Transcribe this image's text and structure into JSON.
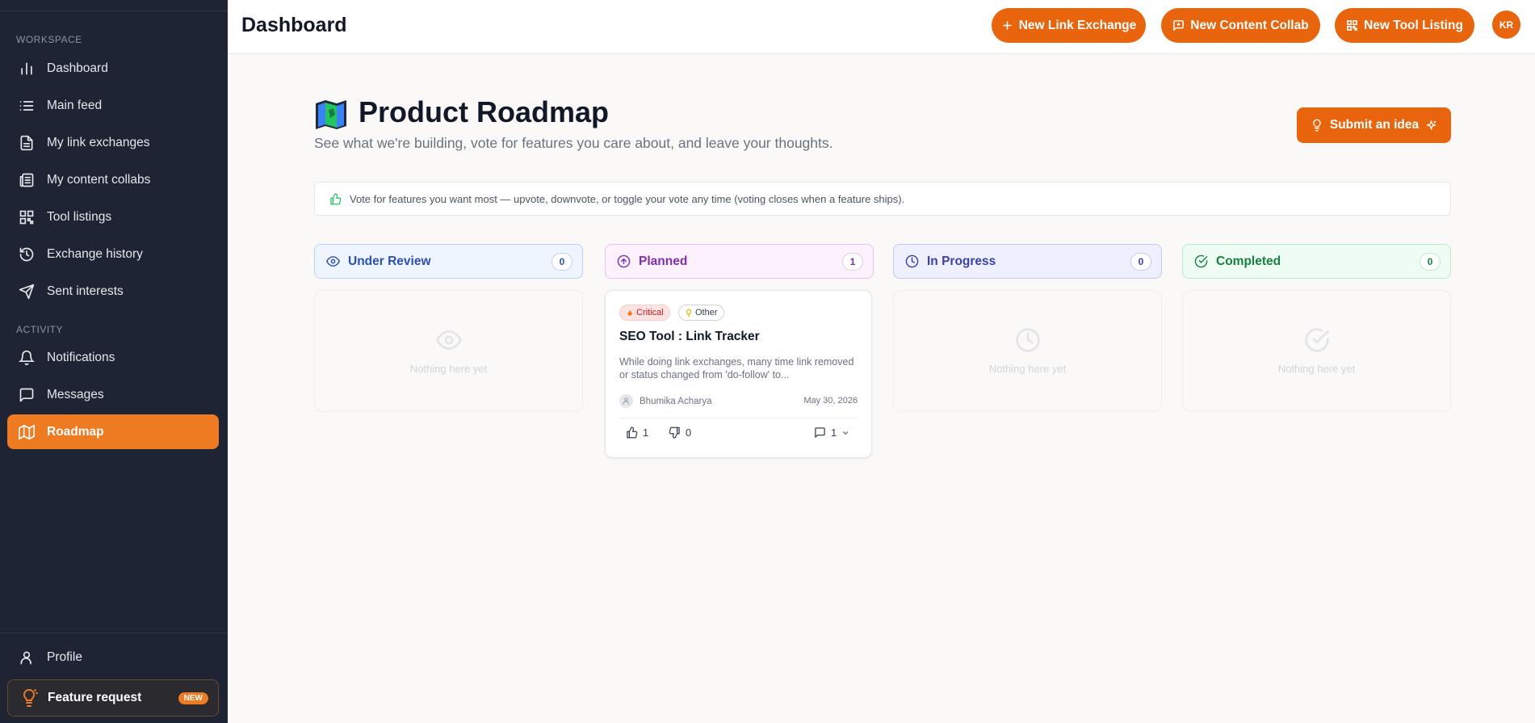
{
  "sidebar": {
    "workspace_label": "WORKSPACE",
    "activity_label": "ACTIVITY",
    "workspace_items": [
      {
        "label": "Dashboard",
        "icon": "chart-bar-icon"
      },
      {
        "label": "Main feed",
        "icon": "list-icon"
      },
      {
        "label": "My link exchanges",
        "icon": "document-icon"
      },
      {
        "label": "My content collabs",
        "icon": "newspaper-icon"
      },
      {
        "label": "Tool listings",
        "icon": "qr-code-icon"
      },
      {
        "label": "Exchange history",
        "icon": "history-icon"
      },
      {
        "label": "Sent interests",
        "icon": "send-icon"
      }
    ],
    "activity_items": [
      {
        "label": "Notifications",
        "icon": "bell-icon"
      },
      {
        "label": "Messages",
        "icon": "message-icon"
      },
      {
        "label": "Roadmap",
        "icon": "map-icon",
        "active": true
      }
    ],
    "profile_label": "Profile",
    "feature_request_label": "Feature request",
    "feature_request_badge": "NEW"
  },
  "header": {
    "title": "Dashboard",
    "buttons": [
      {
        "label": "New Link Exchange",
        "icon": "plus-icon"
      },
      {
        "label": "New Content Collab",
        "icon": "message-plus-icon"
      },
      {
        "label": "New Tool Listing",
        "icon": "qr-code-icon"
      }
    ],
    "avatar_initials": "KR"
  },
  "page": {
    "title": "Product Roadmap",
    "subtitle": "See what we're building, vote for features you care about, and leave your thoughts.",
    "submit_label": "Submit an idea",
    "banner_text": "Vote for features you want most — upvote, downvote, or toggle your vote any time (voting closes when a feature ships)."
  },
  "columns": [
    {
      "label": "Under Review",
      "count": "0",
      "empty_text": "Nothing here yet",
      "icon": "eye-icon",
      "color": "#2f4fb0"
    },
    {
      "label": "Planned",
      "count": "1",
      "icon": "arrow-up-circle-icon",
      "color": "#7e2fb0"
    },
    {
      "label": "In Progress",
      "count": "0",
      "empty_text": "Nothing here yet",
      "icon": "clock-icon",
      "color": "#3b3fa8"
    },
    {
      "label": "Completed",
      "count": "0",
      "empty_text": "Nothing here yet",
      "icon": "check-circle-icon",
      "color": "#15803d"
    }
  ],
  "card": {
    "tags": [
      "Critical",
      "Other"
    ],
    "title": "SEO Tool : Link Tracker",
    "description": "While doing link exchanges, many time link removed or status changed from 'do-follow' to...",
    "author": "Bhumika Acharya",
    "date": "May 30, 2026",
    "upvotes": "1",
    "downvotes": "0",
    "comments": "1"
  },
  "colors": {
    "accent": "#e8650e",
    "sidebar_bg": "#1e2433",
    "active_nav": "#ee7a22"
  }
}
